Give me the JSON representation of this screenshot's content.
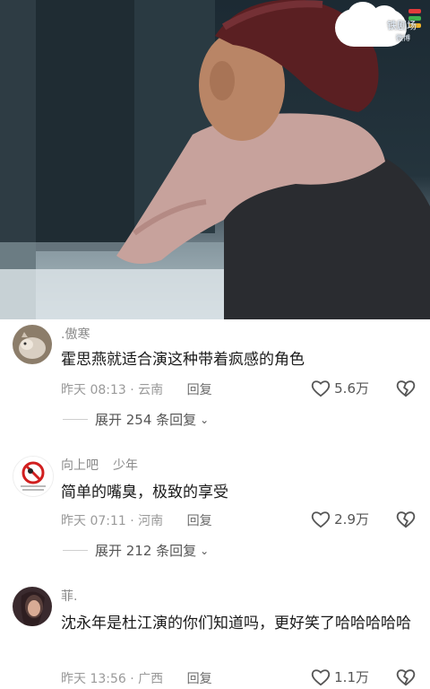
{
  "video": {
    "watermark_text": "铁剧场",
    "watermark_sub": "微博",
    "watermark_colors": [
      "#e23b3b",
      "#3fb34f",
      "#f0b429"
    ]
  },
  "comments": [
    {
      "username": ".傲寒",
      "tag": "",
      "text": "霍思燕就适合演这种带着疯感的角色",
      "time_location": "昨天 08:13 · 云南",
      "reply_label": "回复",
      "likes": "5.6万",
      "expand_label": "展开 254 条回复",
      "avatar_icon": "cat-photo"
    },
    {
      "username": "向上吧",
      "tag": "少年",
      "text": "简单的嘴臭，极致的享受",
      "time_location": "昨天 07:11 · 河南",
      "reply_label": "回复",
      "likes": "2.9万",
      "expand_label": "展开 212 条回复",
      "avatar_icon": "no-sign"
    },
    {
      "username": "菲.",
      "tag": "",
      "text": "沈永年是杜江演的你们知道吗，更好笑了哈哈哈哈哈",
      "time_location": "昨天 13:56 · 广西",
      "reply_label": "回复",
      "likes": "1.1万",
      "expand_label": "",
      "avatar_icon": "woman-photo"
    }
  ]
}
